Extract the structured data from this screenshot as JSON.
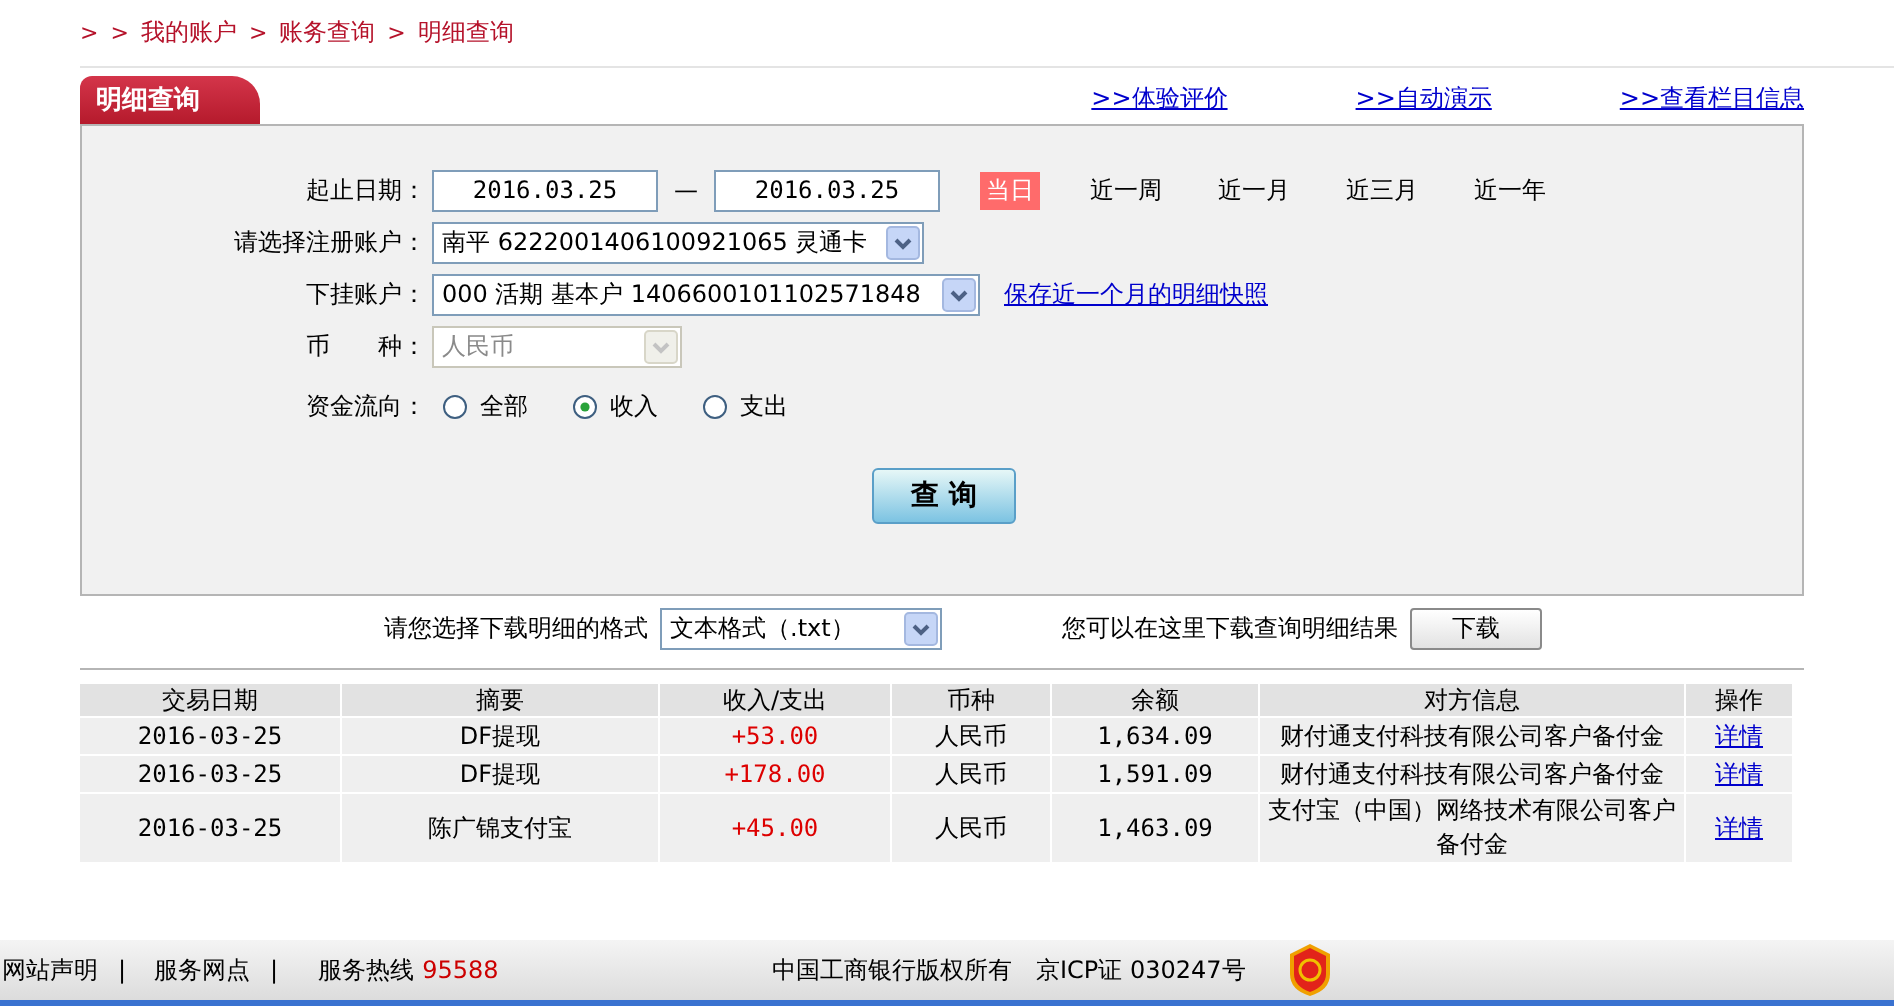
{
  "breadcrumb": [
    {
      "text": ">",
      "kind": "sep"
    },
    {
      "text": ">",
      "kind": "sep"
    },
    {
      "text": "我的账户",
      "kind": "link"
    },
    {
      "text": ">",
      "kind": "sep"
    },
    {
      "text": "账务查询",
      "kind": "link"
    },
    {
      "text": ">",
      "kind": "sep"
    },
    {
      "text": "明细查询",
      "kind": "link"
    }
  ],
  "panel_tab": "明细查询",
  "top_links": [
    ">>体验评价",
    ">>自动演示",
    ">>查看栏目信息"
  ],
  "date_range": {
    "label": "起止日期：",
    "start": "2016.03.25",
    "separator": "—",
    "end": "2016.03.25"
  },
  "quick_periods": [
    {
      "label": "当日",
      "selected": true
    },
    {
      "label": "近一周",
      "selected": false
    },
    {
      "label": "近一月",
      "selected": false
    },
    {
      "label": "近三月",
      "selected": false
    },
    {
      "label": "近一年",
      "selected": false
    }
  ],
  "account": {
    "label": "请选择注册账户：",
    "value": "南平 6222001406100921065 灵通卡"
  },
  "sub_account": {
    "label": "下挂账户：",
    "value": "000 活期 基本户 1406600101102571848",
    "link": "保存近一个月的明细快照"
  },
  "currency": {
    "label": "币　　种：",
    "value": "人民币",
    "disabled": true
  },
  "flow": {
    "label": "资金流向：",
    "options": [
      {
        "label": "全部",
        "selected": false
      },
      {
        "label": "收入",
        "selected": true
      },
      {
        "label": "支出",
        "selected": false
      }
    ]
  },
  "query_button": "查 询",
  "download": {
    "label": "请您选择下载明细的格式",
    "format": "文本格式（.txt）",
    "hint": "您可以在这里下载查询明细结果",
    "button": "下载"
  },
  "table": {
    "columns": [
      "交易日期",
      "摘要",
      "收入/支出",
      "币种",
      "余额",
      "对方信息",
      "操作"
    ],
    "rows": [
      {
        "date": "2016-03-25",
        "summary": "DF提现",
        "amount": "+53.00",
        "currency": "人民币",
        "balance": "1,634.09",
        "counterparty": "财付通支付科技有限公司客户备付金",
        "action": "详情"
      },
      {
        "date": "2016-03-25",
        "summary": "DF提现",
        "amount": "+178.00",
        "currency": "人民币",
        "balance": "1,591.09",
        "counterparty": "财付通支付科技有限公司客户备付金",
        "action": "详情"
      },
      {
        "date": "2016-03-25",
        "summary": "陈广锦支付宝",
        "amount": "+45.00",
        "currency": "人民币",
        "balance": "1,463.09",
        "counterparty": "支付宝（中国）网络技术有限公司客户备付金",
        "action": "详情"
      }
    ]
  },
  "footer": {
    "items": [
      {
        "text": "网站声明",
        "kind": "link"
      },
      {
        "text": "|",
        "kind": "sep"
      },
      {
        "text": "服务网点",
        "kind": "link"
      },
      {
        "text": "|",
        "kind": "sep"
      },
      {
        "text": "服务热线",
        "kind": "label"
      },
      {
        "text": "95588",
        "kind": "hotline"
      }
    ],
    "copyright": "中国工商银行版权所有",
    "icp": "京ICP证 030247号"
  }
}
